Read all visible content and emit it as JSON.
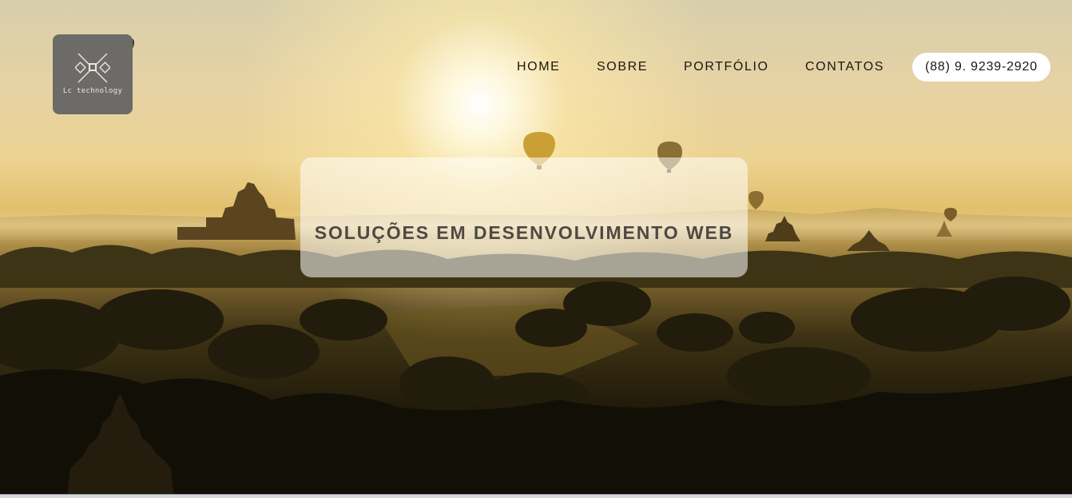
{
  "logo": {
    "icon": "lc-technology-logo",
    "name": "Lc technology",
    "pin_icon": "map-pin-icon"
  },
  "nav": {
    "items": [
      {
        "label": "HOME"
      },
      {
        "label": "SOBRE"
      },
      {
        "label": "PORTFÓLIO"
      },
      {
        "label": "CONTATOS"
      }
    ],
    "phone": "(88) 9. 9239-2920"
  },
  "hero": {
    "headline": "SOLUÇÕES EM DESENVOLVIMENTO WEB",
    "background": "sunrise-landscape-with-hot-air-balloons"
  },
  "colors": {
    "logo_bg": "#6c6b67",
    "nav_text": "#1b170e",
    "headline_text": "#4e4a42",
    "phone_bg": "#ffffff"
  }
}
